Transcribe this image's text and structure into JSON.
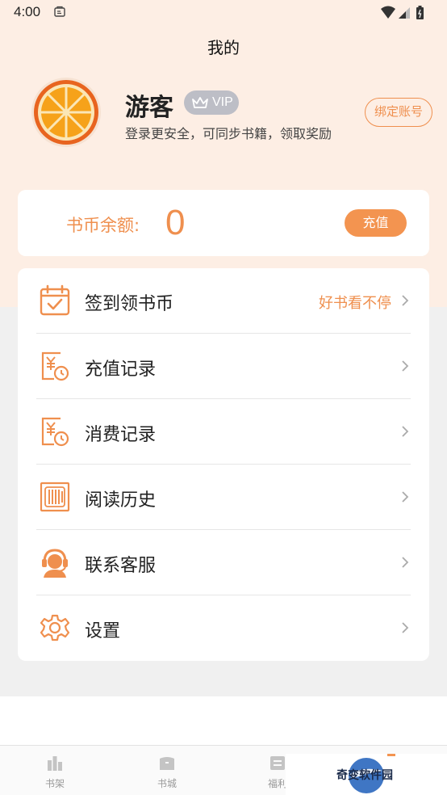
{
  "status_bar": {
    "time": "4:00"
  },
  "header": {
    "title": "我的"
  },
  "profile": {
    "name": "游客",
    "vip_label": "VIP",
    "subtitle": "登录更安全，可同步书籍，领取奖励",
    "bind_button": "绑定账号"
  },
  "balance": {
    "label": "书币余额:",
    "value": "0",
    "recharge_button": "充值"
  },
  "menu": {
    "items": [
      {
        "label": "签到领书币",
        "extra": "好书看不停",
        "icon": "calendar-check-icon"
      },
      {
        "label": "充值记录",
        "extra": "",
        "icon": "yuan-record-icon"
      },
      {
        "label": "消费记录",
        "extra": "",
        "icon": "yuan-record-icon"
      },
      {
        "label": "阅读历史",
        "extra": "",
        "icon": "reading-history-icon"
      },
      {
        "label": "联系客服",
        "extra": "",
        "icon": "customer-service-icon"
      },
      {
        "label": "设置",
        "extra": "",
        "icon": "gear-icon"
      }
    ]
  },
  "tabs": [
    {
      "label": "书架",
      "icon": "bookshelf-icon"
    },
    {
      "label": "书城",
      "icon": "bookstore-icon"
    },
    {
      "label": "福利",
      "icon": "welfare-icon"
    }
  ],
  "watermark": {
    "text": "奇变软件园"
  },
  "colors": {
    "accent": "#ef8f4e",
    "header_bg": "#fdeee4",
    "page_bg": "#f0f0f0"
  }
}
